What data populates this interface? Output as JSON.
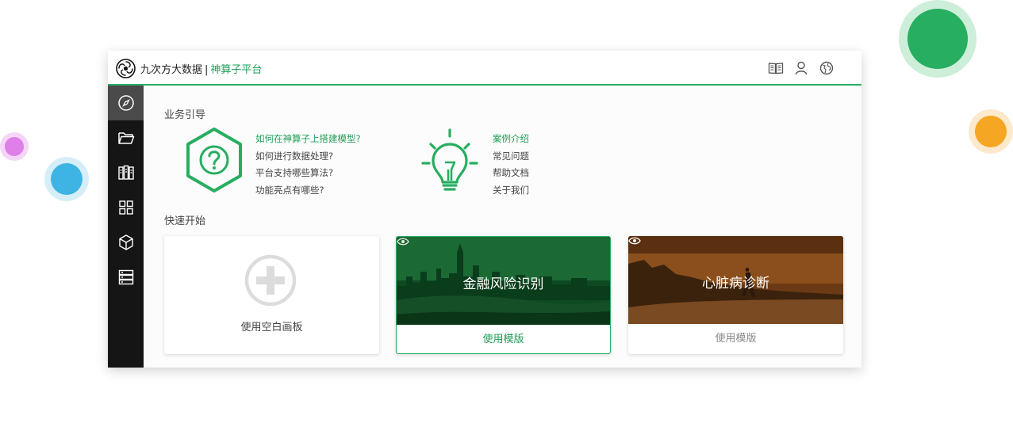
{
  "header": {
    "brand_name": "九次方大数据",
    "separator": "|",
    "platform_name": "神算子平台",
    "icons": [
      "book-icon",
      "user-icon",
      "globe-icon"
    ]
  },
  "sidebar": {
    "items": [
      {
        "icon": "compass-icon",
        "active": true
      },
      {
        "icon": "folder-icon",
        "active": false
      },
      {
        "icon": "library-icon",
        "active": false
      },
      {
        "icon": "grid-icon",
        "active": false
      },
      {
        "icon": "cube-icon",
        "active": false
      },
      {
        "icon": "server-icon",
        "active": false
      }
    ]
  },
  "guide": {
    "title": "业务引导",
    "faq_links": [
      "如何在神算子上搭建模型?",
      "如何进行数据处理?",
      "平台支持哪些算法?",
      "功能亮点有哪些?"
    ],
    "info_links": [
      "案例介绍",
      "常见问题",
      "帮助文档",
      "关于我们"
    ]
  },
  "quick_start": {
    "title": "快速开始",
    "blank_card": {
      "label": "使用空白画板"
    },
    "templates": [
      {
        "title": "金融风险识别",
        "action": "使用模版"
      },
      {
        "title": "心脏病诊断",
        "action": "使用模版"
      }
    ]
  },
  "colors": {
    "accent": "#27ae60",
    "accent_text": "#1e9e55",
    "sidebar_bg": "#151515",
    "sidebar_active": "#4a4a4a"
  }
}
